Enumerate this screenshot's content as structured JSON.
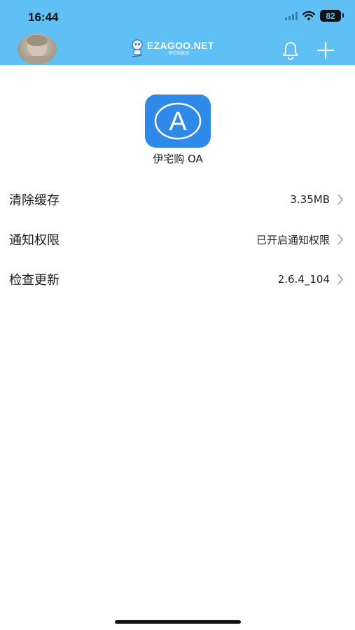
{
  "status_bar": {
    "time": "16:44",
    "battery": "82",
    "wifi_icon": "wifi-icon",
    "signal_icon": "cellular-signal-icon"
  },
  "header": {
    "avatar_icon": "user-avatar",
    "logo_text": "EZAGOO.NET",
    "logo_subtext": "伊宅购集团",
    "bell_icon": "bell-icon",
    "plus_icon": "plus-icon",
    "color": "#5ec0f5"
  },
  "app": {
    "icon_letter": "A",
    "icon_color": "#2f89e8",
    "name": "伊宅购 OA"
  },
  "settings": [
    {
      "label": "清除缓存",
      "value": "3.35MB"
    },
    {
      "label": "通知权限",
      "value": "已开启通知权限"
    },
    {
      "label": "检查更新",
      "value": "2.6.4_104"
    }
  ]
}
